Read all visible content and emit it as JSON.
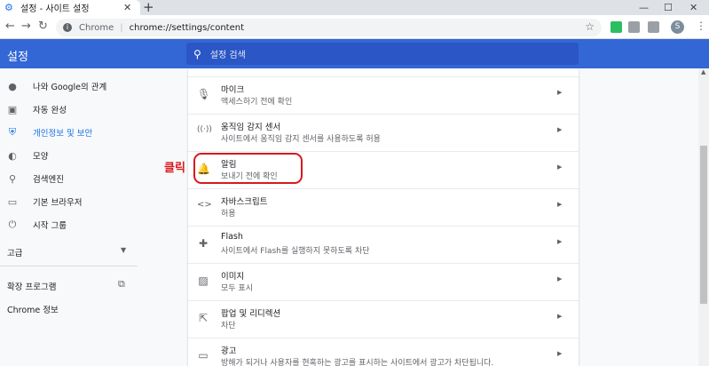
{
  "browser": {
    "tab_title": "설정 - 사이트 설정",
    "tab_close": "✕",
    "new_tab": "+",
    "window_controls": {
      "minimize": "—",
      "maximize": "☐",
      "close": "✕"
    },
    "nav": {
      "back": "←",
      "forward": "→",
      "reload": "↻"
    },
    "omnibox": {
      "site_name": "Chrome",
      "separator": "|",
      "url": "chrome://settings/content"
    },
    "profile_initial": "S",
    "extension_icons": [
      "evernote-icon",
      "camera-icon",
      "chart-icon"
    ]
  },
  "header": {
    "title": "설정",
    "search_placeholder": "설정 검색"
  },
  "sidebar": {
    "items": [
      {
        "label": "나와 Google의 관계",
        "icon": "person-icon",
        "glyph": "👤"
      },
      {
        "label": "자동 완성",
        "icon": "clipboard-icon",
        "glyph": "▣"
      },
      {
        "label": "개인정보 및 보안",
        "icon": "shield-icon",
        "glyph": "⛨",
        "active": true
      },
      {
        "label": "모양",
        "icon": "palette-icon",
        "glyph": "◐"
      },
      {
        "label": "검색엔진",
        "icon": "search-icon",
        "glyph": "⌕"
      },
      {
        "label": "기본 브라우저",
        "icon": "browser-icon",
        "glyph": "▭"
      },
      {
        "label": "시작 그룹",
        "icon": "power-icon",
        "glyph": "⏻"
      }
    ],
    "advanced_label": "고급",
    "extensions_label": "확장 프로그램",
    "about_label": "Chrome 정보"
  },
  "settings_rows": [
    {
      "title": "마이크",
      "subtitle": "액세스하기 전에 확인",
      "icon": "microphone-icon",
      "glyph": "🎤"
    },
    {
      "title": "움직임 감지 센서",
      "subtitle": "사이트에서 움직임 감지 센서를 사용하도록 허용",
      "icon": "sensor-icon",
      "glyph": "((·))"
    },
    {
      "title": "알림",
      "subtitle": "보내기 전에 확인",
      "icon": "bell-icon",
      "glyph": "🔔"
    },
    {
      "title": "자바스크립트",
      "subtitle": "허용",
      "icon": "code-icon",
      "glyph": "<>"
    },
    {
      "title": "Flash",
      "subtitle": "사이트에서 Flash를 실행하지 못하도록 차단",
      "icon": "puzzle-icon",
      "glyph": "✚"
    },
    {
      "title": "이미지",
      "subtitle": "모두 표시",
      "icon": "image-icon",
      "glyph": "▨"
    },
    {
      "title": "팝업 및 리디렉션",
      "subtitle": "차단",
      "icon": "popup-icon",
      "glyph": "⇱"
    },
    {
      "title": "광고",
      "subtitle": "방해가 되거나 사용자를 현혹하는 광고를 표시하는 사이트에서 광고가 차단됩니다.",
      "icon": "ad-icon",
      "glyph": "▭"
    }
  ],
  "annotation": {
    "label": "클릭",
    "color": "#d7191e"
  },
  "colors": {
    "header_bg": "#3367d6",
    "accent": "#1a73e8"
  }
}
